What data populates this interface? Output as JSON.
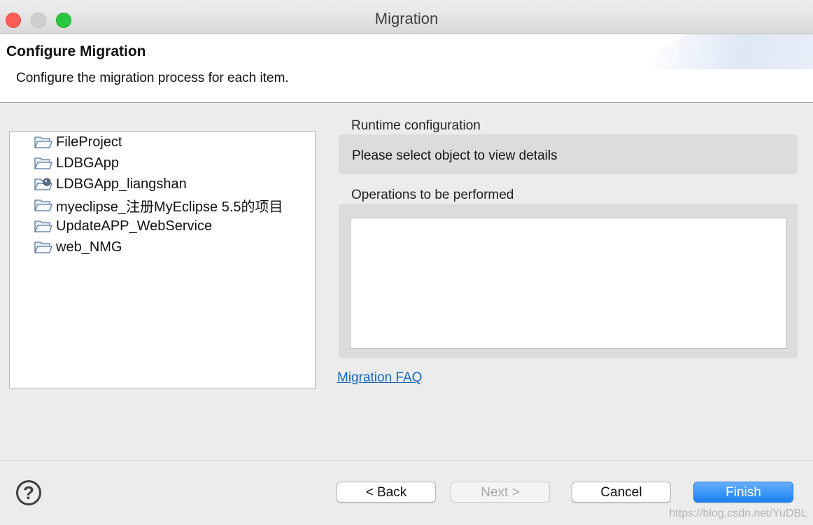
{
  "window": {
    "title": "Migration",
    "controls": [
      "close",
      "minimize",
      "maximize"
    ]
  },
  "header": {
    "title": "Configure Migration",
    "description": "Configure the migration process for each item."
  },
  "tree": {
    "items": [
      {
        "label": "FileProject",
        "icon": "folder-icon"
      },
      {
        "label": "LDBGApp",
        "icon": "folder-icon"
      },
      {
        "label": "LDBGApp_liangshan",
        "icon": "folder-overlay-icon"
      },
      {
        "label": "myeclipse_注册MyEclipse 5.5的项目",
        "icon": "folder-icon"
      },
      {
        "label": "UpdateAPP_WebService",
        "icon": "folder-icon"
      },
      {
        "label": "web_NMG",
        "icon": "folder-icon"
      }
    ]
  },
  "runtime": {
    "label": "Runtime configuration",
    "placeholder": "Please select object to view details"
  },
  "operations": {
    "label": "Operations to be performed",
    "items": []
  },
  "faq_link": "Migration FAQ",
  "footer": {
    "help": "?",
    "back": "< Back",
    "next": "Next >",
    "cancel": "Cancel",
    "finish": "Finish"
  },
  "watermark": "https://blog.csdn.net/YuDBL",
  "colors": {
    "accent": "#1a82f5",
    "link": "#1565c0",
    "close": "#fc5f57",
    "maximize": "#2ac840"
  }
}
